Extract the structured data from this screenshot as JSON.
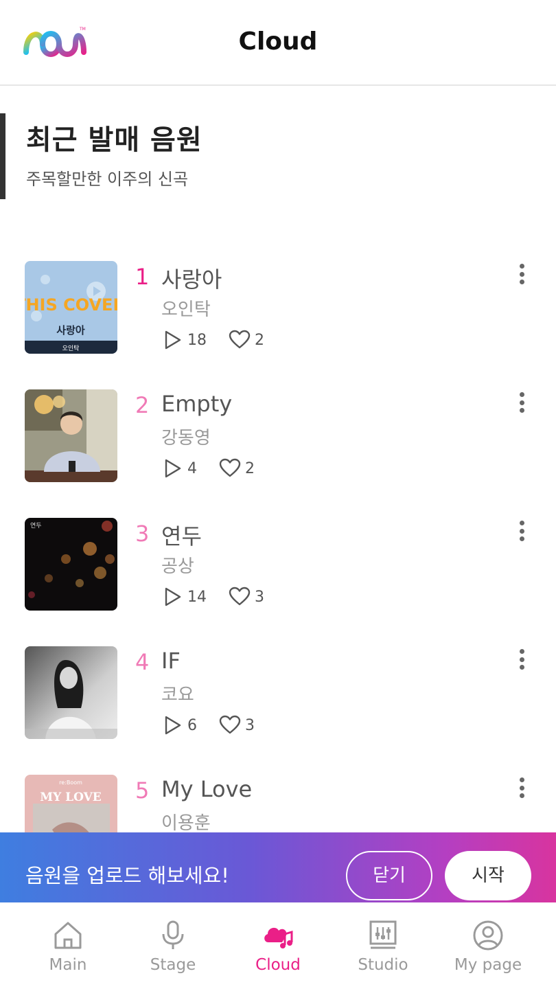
{
  "header": {
    "title": "Cloud",
    "logo_icon": "mm-logo"
  },
  "section": {
    "title": "최근 발매 음원",
    "subtitle": "주목할만한 이주의 신곡"
  },
  "tracks": [
    {
      "rank": "1",
      "title": "사랑아",
      "artist": "오인탁",
      "plays": "18",
      "likes": "2",
      "cover_title": "THIS COVER",
      "cover_song": "사랑아",
      "cover_artist": "오인탁"
    },
    {
      "rank": "2",
      "title": "Empty",
      "artist": "강동영",
      "plays": "4",
      "likes": "2"
    },
    {
      "rank": "3",
      "title": "연두",
      "artist": "공상",
      "plays": "14",
      "likes": "3",
      "cover_text": "연두"
    },
    {
      "rank": "4",
      "title": "IF",
      "artist": "코요",
      "plays": "6",
      "likes": "3"
    },
    {
      "rank": "5",
      "title": "My Love",
      "artist": "이용훈",
      "cover_title": "MY LOVE",
      "cover_label": "re:Boom"
    }
  ],
  "banner": {
    "text": "음원을 업로드 해보세요!",
    "close_label": "닫기",
    "start_label": "시작"
  },
  "nav": [
    {
      "label": "Main",
      "icon": "home-icon"
    },
    {
      "label": "Stage",
      "icon": "microphone-icon"
    },
    {
      "label": "Cloud",
      "icon": "cloud-music-icon",
      "active": true
    },
    {
      "label": "Studio",
      "icon": "studio-mixer-icon"
    },
    {
      "label": "My page",
      "icon": "user-circle-icon"
    }
  ],
  "colors": {
    "accent": "#ea1f87",
    "rank": "#f07ab6",
    "banner_start": "#3f7ee0",
    "banner_end": "#d8349f"
  }
}
